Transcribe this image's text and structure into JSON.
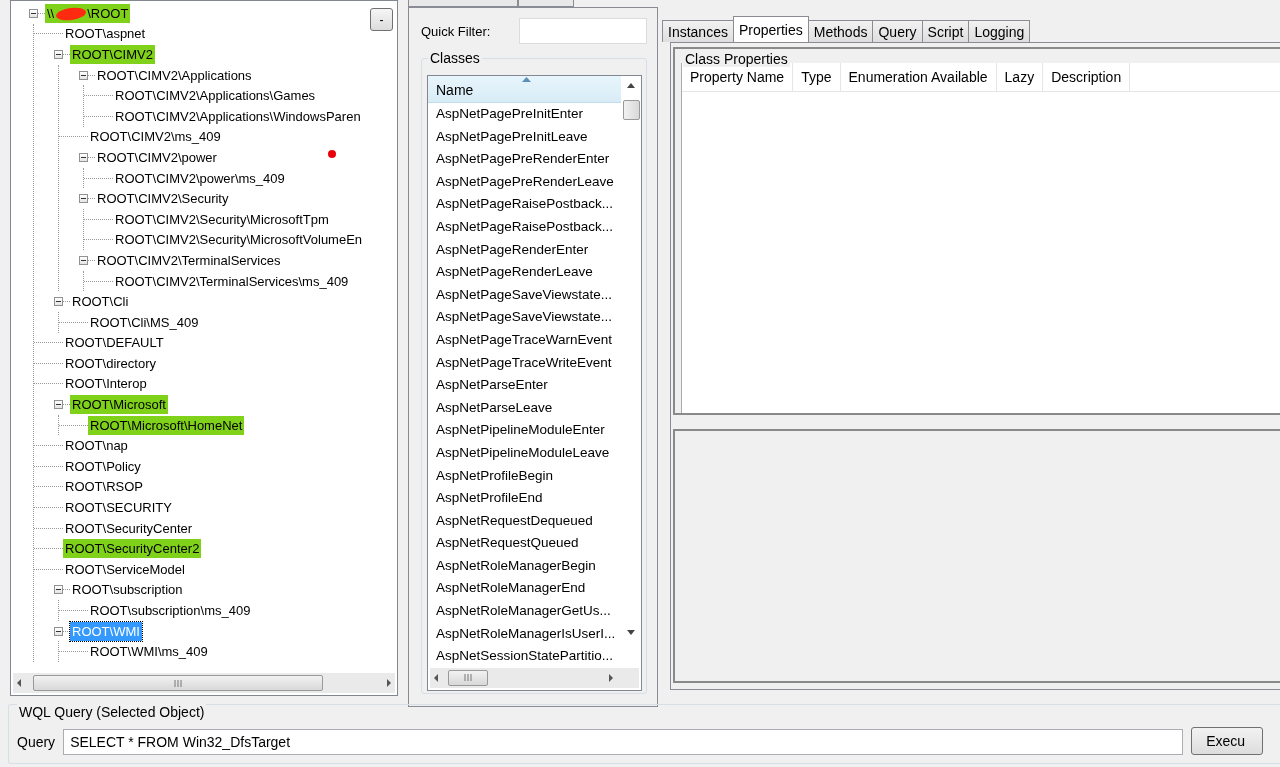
{
  "namespace_tree": {
    "collapse_button": "-",
    "root": {
      "label_start": "\\\\",
      "label_end": "\\ROOT",
      "redacted": true,
      "highlighted": true,
      "selected": false,
      "expanded": true,
      "children": [
        {
          "label": "ROOT\\aspnet",
          "highlighted": false,
          "selected": false
        },
        {
          "label": "ROOT\\CIMV2",
          "highlighted": true,
          "selected": false,
          "expanded": true,
          "children": [
            {
              "label": "ROOT\\CIMV2\\Applications",
              "highlighted": false,
              "selected": false,
              "expanded": true,
              "children": [
                {
                  "label": "ROOT\\CIMV2\\Applications\\Games",
                  "highlighted": false,
                  "selected": false
                },
                {
                  "label": "ROOT\\CIMV2\\Applications\\WindowsParen",
                  "highlighted": false,
                  "selected": false
                }
              ]
            },
            {
              "label": "ROOT\\CIMV2\\ms_409",
              "highlighted": false,
              "selected": false
            },
            {
              "label": "ROOT\\CIMV2\\power",
              "highlighted": false,
              "selected": false,
              "expanded": true,
              "children": [
                {
                  "label": "ROOT\\CIMV2\\power\\ms_409",
                  "highlighted": false,
                  "selected": false
                }
              ]
            },
            {
              "label": "ROOT\\CIMV2\\Security",
              "highlighted": false,
              "selected": false,
              "expanded": true,
              "children": [
                {
                  "label": "ROOT\\CIMV2\\Security\\MicrosoftTpm",
                  "highlighted": false,
                  "selected": false
                },
                {
                  "label": "ROOT\\CIMV2\\Security\\MicrosoftVolumeEn",
                  "highlighted": false,
                  "selected": false
                }
              ]
            },
            {
              "label": "ROOT\\CIMV2\\TerminalServices",
              "highlighted": false,
              "selected": false,
              "expanded": true,
              "children": [
                {
                  "label": "ROOT\\CIMV2\\TerminalServices\\ms_409",
                  "highlighted": false,
                  "selected": false
                }
              ]
            }
          ]
        },
        {
          "label": "ROOT\\Cli",
          "highlighted": false,
          "selected": false,
          "expanded": true,
          "children": [
            {
              "label": "ROOT\\Cli\\MS_409",
              "highlighted": false,
              "selected": false
            }
          ]
        },
        {
          "label": "ROOT\\DEFAULT",
          "highlighted": false,
          "selected": false
        },
        {
          "label": "ROOT\\directory",
          "highlighted": false,
          "selected": false
        },
        {
          "label": "ROOT\\Interop",
          "highlighted": false,
          "selected": false
        },
        {
          "label": "ROOT\\Microsoft",
          "highlighted": true,
          "selected": false,
          "expanded": true,
          "children": [
            {
              "label": "ROOT\\Microsoft\\HomeNet",
              "highlighted": true,
              "selected": false
            }
          ]
        },
        {
          "label": "ROOT\\nap",
          "highlighted": false,
          "selected": false
        },
        {
          "label": "ROOT\\Policy",
          "highlighted": false,
          "selected": false
        },
        {
          "label": "ROOT\\RSOP",
          "highlighted": false,
          "selected": false
        },
        {
          "label": "ROOT\\SECURITY",
          "highlighted": false,
          "selected": false
        },
        {
          "label": "ROOT\\SecurityCenter",
          "highlighted": false,
          "selected": false
        },
        {
          "label": "ROOT\\SecurityCenter2",
          "highlighted": true,
          "selected": false
        },
        {
          "label": "ROOT\\ServiceModel",
          "highlighted": false,
          "selected": false
        },
        {
          "label": "ROOT\\subscription",
          "highlighted": false,
          "selected": false,
          "expanded": true,
          "children": [
            {
              "label": "ROOT\\subscription\\ms_409",
              "highlighted": false,
              "selected": false
            }
          ]
        },
        {
          "label": "ROOT\\WMI",
          "highlighted": false,
          "selected": true,
          "expanded": true,
          "children": [
            {
              "label": "ROOT\\WMI\\ms_409",
              "highlighted": false,
              "selected": false
            }
          ]
        }
      ]
    }
  },
  "classes_pane": {
    "quick_filter_label": "Quick Filter:",
    "classes_group": "Classes",
    "column_header": "Name",
    "items": [
      "AspNetPagePreInitEnter",
      "AspNetPagePreInitLeave",
      "AspNetPagePreRenderEnter",
      "AspNetPagePreRenderLeave",
      "AspNetPageRaisePostback...",
      "AspNetPageRaisePostback...",
      "AspNetPageRenderEnter",
      "AspNetPageRenderLeave",
      "AspNetPageSaveViewstate...",
      "AspNetPageSaveViewstate...",
      "AspNetPageTraceWarnEvent",
      "AspNetPageTraceWriteEvent",
      "AspNetParseEnter",
      "AspNetParseLeave",
      "AspNetPipelineModuleEnter",
      "AspNetPipelineModuleLeave",
      "AspNetProfileBegin",
      "AspNetProfileEnd",
      "AspNetRequestDequeued",
      "AspNetRequestQueued",
      "AspNetRoleManagerBegin",
      "AspNetRoleManagerEnd",
      "AspNetRoleManagerGetUs...",
      "AspNetRoleManagerIsUserI...",
      "AspNetSessionStatePartitio..."
    ]
  },
  "detail_tabs": [
    {
      "label": "Instances",
      "selected": false
    },
    {
      "label": "Properties",
      "selected": true
    },
    {
      "label": "Methods",
      "selected": false
    },
    {
      "label": "Query",
      "selected": false
    },
    {
      "label": "Script",
      "selected": false
    },
    {
      "label": "Logging",
      "selected": false
    }
  ],
  "class_properties": {
    "title": "Class Properties",
    "columns": [
      "Property Name",
      "Type",
      "Enumeration Available",
      "Lazy",
      "Description"
    ]
  },
  "wql_query": {
    "title": "WQL Query (Selected Object)",
    "query_label": "Query",
    "query_value": "SELECT * FROM Win32_DfsTarget",
    "execute_button": "Execu"
  }
}
